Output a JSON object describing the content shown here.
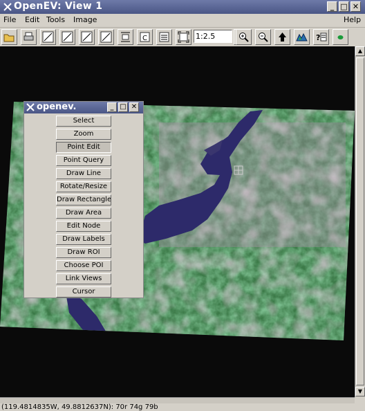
{
  "window": {
    "title": "OpenEV: View 1"
  },
  "menubar": {
    "items": [
      "File",
      "Edit",
      "Tools",
      "Image"
    ],
    "help": "Help"
  },
  "toolbar": {
    "zoom_value": "1:2.5",
    "icons": [
      "open-icon",
      "print-icon",
      "line-tool-icon",
      "line-tool-icon",
      "line-tool-icon",
      "line-tool-icon",
      "fit-height-icon",
      "clear-icon",
      "list-icon",
      "fit-extents-icon",
      "zoom-in-icon",
      "zoom-out-icon",
      "home-arrow-icon",
      "terrain-icon",
      "legend-icon",
      "layer-dot-icon"
    ]
  },
  "palette": {
    "title": "openev.",
    "tools": [
      "Select",
      "Zoom",
      "Point Edit",
      "Point Query",
      "Draw Line",
      "Rotate/Resize",
      "Draw Rectangle",
      "Draw Area",
      "Edit Node",
      "Draw Labels",
      "Draw ROI",
      "Choose POI",
      "Link Views",
      "Cursor"
    ],
    "active_tool": "Point Edit"
  },
  "status": {
    "text": "(119.4814835W, 49.8812637N): 70r 74g 79b"
  },
  "colors": {
    "titlebar": "#5a6696",
    "background": "#d4d0c8",
    "viewport": "#0a0a0a"
  }
}
